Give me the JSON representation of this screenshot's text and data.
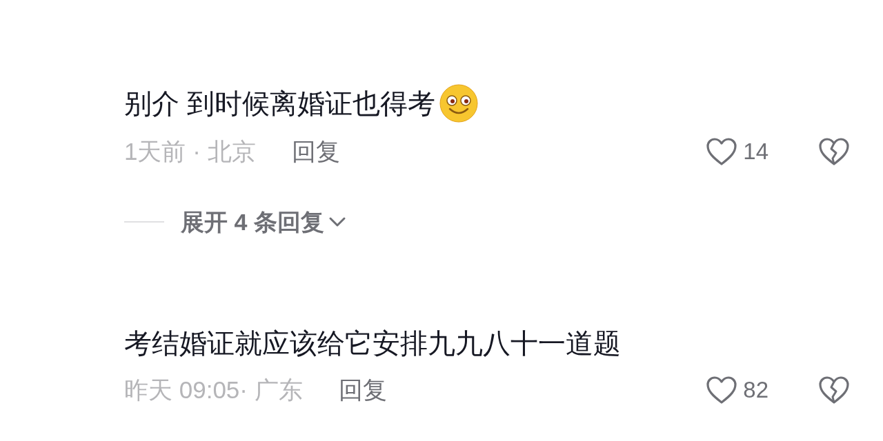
{
  "comments": [
    {
      "text": "别介 到时候离婚证也得考",
      "emoji": true,
      "meta": "1天前 · 北京",
      "reply": "回复",
      "likes": "14",
      "expand": "展开 4 条回复"
    },
    {
      "text": "考结婚证就应该给它安排九九八十一道题",
      "emoji": false,
      "meta": "昨天 09:05· 广东",
      "reply": "回复",
      "likes": "82"
    }
  ]
}
